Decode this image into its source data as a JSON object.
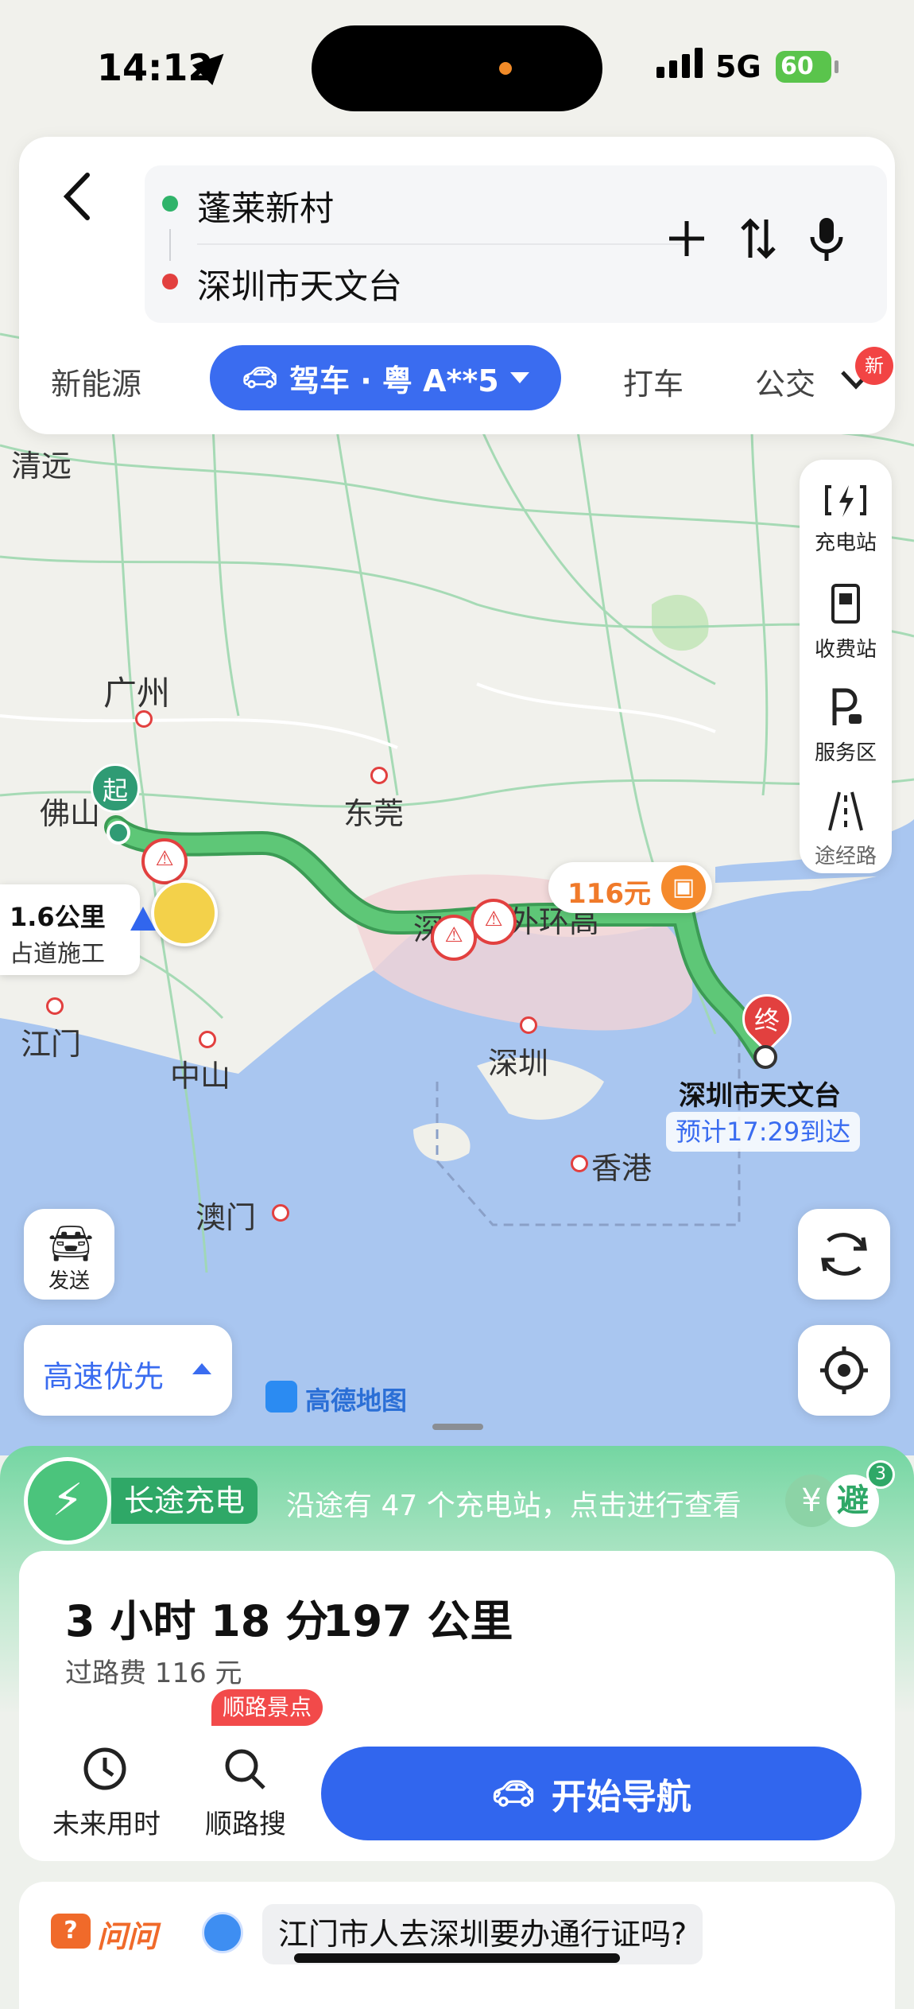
{
  "status_bar": {
    "time": "14:12",
    "network": "5G",
    "battery": "60"
  },
  "route_search": {
    "origin": "蓬莱新村",
    "destination": "深圳市天文台",
    "tabs": [
      "新能源",
      "驾车 · 粤 A**5",
      "打车",
      "公交"
    ],
    "new_badge": "新"
  },
  "side_toolbar": [
    "充电站",
    "收费站",
    "服务区",
    "途经路"
  ],
  "map": {
    "cities": [
      "清远",
      "广州",
      "佛山",
      "东莞",
      "深",
      "外环高",
      "江门",
      "中山",
      "深圳",
      "香港",
      "澳门"
    ],
    "start_marker": "起",
    "end_marker": "终",
    "toll_badge": "116元",
    "incident": {
      "distance": "1.6公里",
      "type": "占道施工"
    },
    "destination_label": "深圳市天文台",
    "eta": "预计17:29到达",
    "send_label": "发送",
    "route_pref": "高速优先",
    "brand": "高德地图"
  },
  "charging_banner": {
    "title": "长途充电",
    "text": "沿途有 47 个充电站，点击进行查看",
    "avoid": "避",
    "avoid_count": "3",
    "yen": "¥"
  },
  "route_summary": {
    "duration": "3 小时 18 分",
    "distance": "197 公里",
    "toll": "过路费 116 元",
    "future_time": "未来用时",
    "along_search": "顺路搜",
    "along_badge": "顺路景点",
    "start_nav": "开始导航"
  },
  "ask": {
    "brand": "问问",
    "question": "江门市人去深圳要办通行证吗?"
  }
}
